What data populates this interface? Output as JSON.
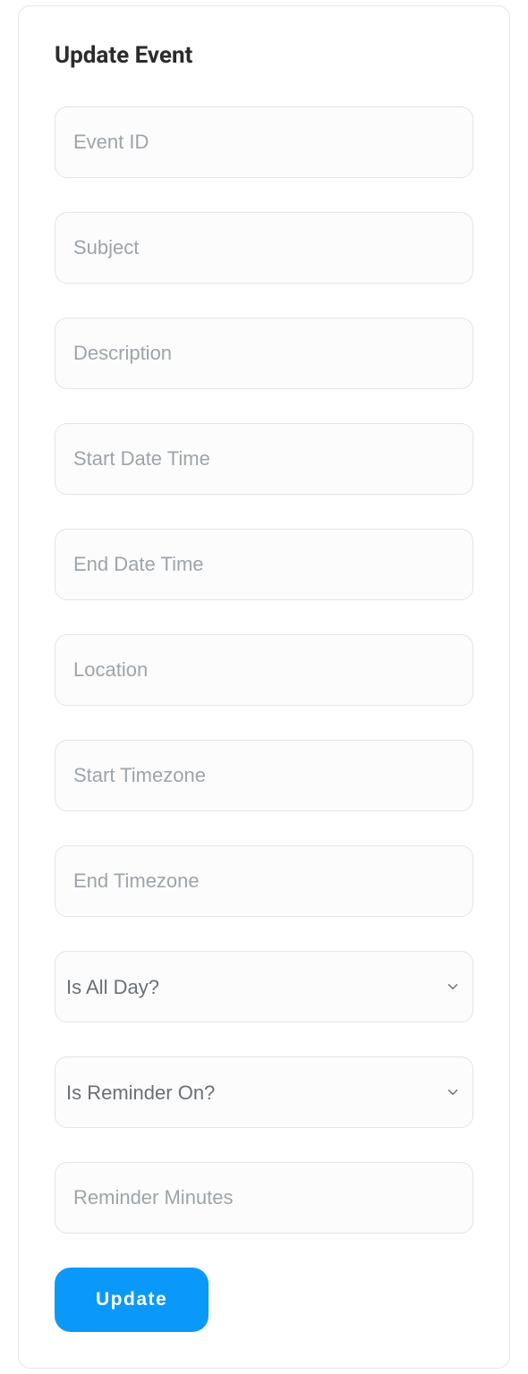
{
  "card": {
    "title": "Update Event"
  },
  "fields": {
    "event_id": {
      "placeholder": "Event ID",
      "value": ""
    },
    "subject": {
      "placeholder": "Subject",
      "value": ""
    },
    "description": {
      "placeholder": "Description",
      "value": ""
    },
    "start_datetime": {
      "placeholder": "Start Date Time",
      "value": ""
    },
    "end_datetime": {
      "placeholder": "End Date Time",
      "value": ""
    },
    "location": {
      "placeholder": "Location",
      "value": ""
    },
    "start_timezone": {
      "placeholder": "Start Timezone",
      "value": ""
    },
    "end_timezone": {
      "placeholder": "End Timezone",
      "value": ""
    },
    "is_all_day": {
      "label": "Is All Day?"
    },
    "is_reminder_on": {
      "label": "Is Reminder On?"
    },
    "reminder_minutes": {
      "placeholder": "Reminder Minutes",
      "value": ""
    }
  },
  "actions": {
    "update_label": "Update"
  }
}
